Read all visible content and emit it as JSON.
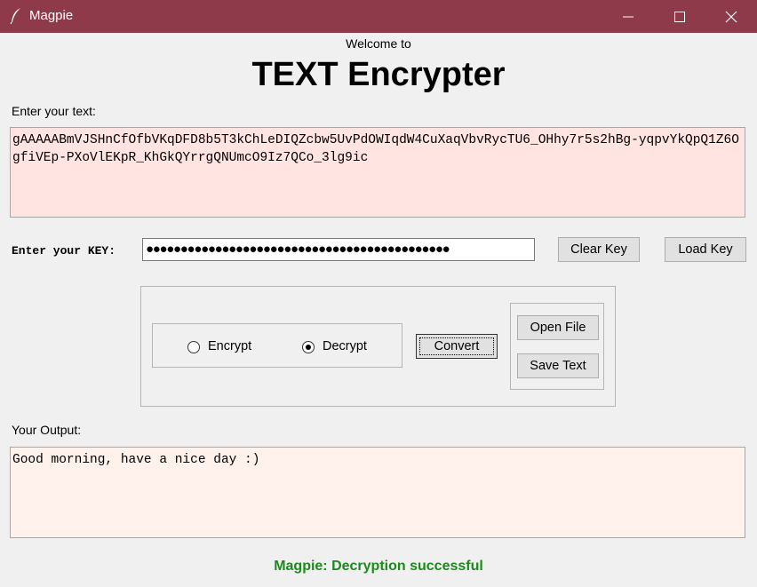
{
  "window": {
    "title": "Magpie",
    "icon": "feather-icon",
    "controls": [
      "minimize-icon",
      "maximize-icon",
      "close-icon"
    ]
  },
  "header": {
    "welcome": "Welcome to",
    "title": "TEXT Encrypter"
  },
  "input": {
    "label": "Enter your text:",
    "value": "gAAAAABmVJSHnCfOfbVKqDFD8b5T3kChLeDIQZcbw5UvPdOWIqdW4CuXaqVbvRycTU6_OHhy7r5s2hBg-yqpvYkQpQ1Z6OgfiVEp-PXoVlEKpR_KhGkQYrrgQNUmcO9Iz7QCo_3lg9ic"
  },
  "key": {
    "label": "Enter your KEY:",
    "masked_value": "●●●●●●●●●●●●●●●●●●●●●●●●●●●●●●●●●●●●●●●●●●●●",
    "clear_label": "Clear Key",
    "load_label": "Load Key"
  },
  "mode": {
    "options": [
      {
        "label": "Encrypt",
        "selected": false
      },
      {
        "label": "Decrypt",
        "selected": true
      }
    ],
    "convert_label": "Convert"
  },
  "file": {
    "open_label": "Open File",
    "save_label": "Save Text"
  },
  "output": {
    "label": "Your Output:",
    "value": "Good morning, have a nice day :)"
  },
  "status": {
    "text": "Magpie: Decryption successful",
    "color": "#1b8a1b"
  },
  "colors": {
    "titlebar": "#8e3a4a",
    "input_bg": "#ffe4e1",
    "output_bg": "#fff2ec"
  }
}
